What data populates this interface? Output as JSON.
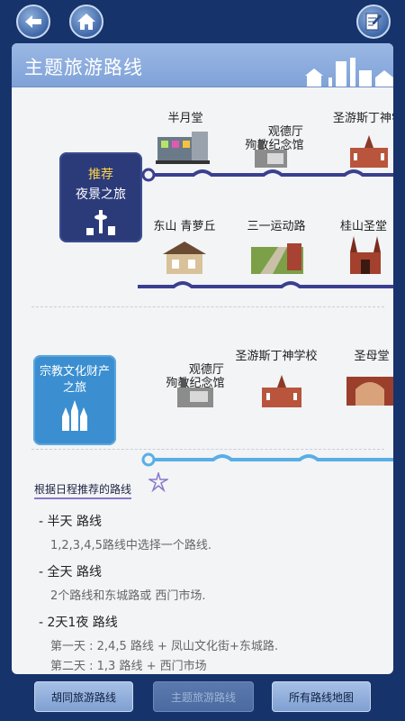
{
  "panel": {
    "title": "主题旅游路线"
  },
  "routes": [
    {
      "badge": {
        "tag": "推荐",
        "title": "夜景之旅"
      },
      "rows": [
        [
          "半月堂",
          "观德厅\n殉教纪念馆",
          "圣游斯丁神学"
        ],
        [
          "东山 青萝丘",
          "三一运动路",
          "桂山圣堂"
        ]
      ]
    },
    {
      "badge": {
        "title": "宗教文化财产\n之旅"
      },
      "rows": [
        [
          "观德厅\n殉教纪念馆",
          "圣游斯丁神学校",
          "圣母堂"
        ]
      ]
    }
  ],
  "tips": {
    "title": "根据日程推荐的路线",
    "items": [
      {
        "title": "- 半天 路线",
        "desc": "1,2,3,4,5路线中选择一个路线."
      },
      {
        "title": "- 全天 路线",
        "desc": "2个路线和东城路或 西门市场."
      },
      {
        "title": "- 2天1夜 路线",
        "desc": "第一天 : 2,4,5 路线 + 凤山文化街+东城路.",
        "desc2": "第二天 : 1,3 路线 + 西门市场"
      }
    ]
  },
  "bottom": {
    "btn1": "胡同旅游路线",
    "btn2": "主题旅游路线",
    "btn3": "所有路线地图"
  },
  "colors": {
    "background": "#17336b",
    "panel_header": "#8eaee0",
    "night_line": "#3b3f8f",
    "religion_line": "#5aaee6"
  }
}
